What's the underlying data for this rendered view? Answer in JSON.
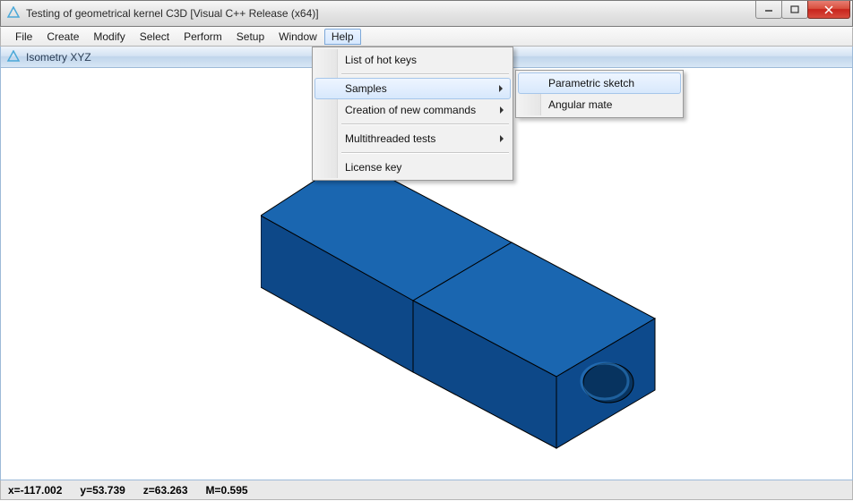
{
  "titlebar": {
    "title": "Testing of geometrical kernel C3D [Visual C++ Release (x64)]"
  },
  "menubar": {
    "items": [
      "File",
      "Create",
      "Modify",
      "Select",
      "Perform",
      "Setup",
      "Window",
      "Help"
    ],
    "open_index": 7
  },
  "view_header": {
    "label": "Isometry XYZ"
  },
  "help_menu": {
    "items": [
      {
        "label": "List of hot keys",
        "submenu": false
      },
      {
        "separator": true
      },
      {
        "label": "Samples",
        "submenu": true,
        "hover": true
      },
      {
        "label": "Creation of new commands",
        "submenu": true
      },
      {
        "separator": true
      },
      {
        "label": "Multithreaded tests",
        "submenu": true
      },
      {
        "separator": true
      },
      {
        "label": "License key",
        "submenu": false
      }
    ]
  },
  "samples_submenu": {
    "items": [
      {
        "label": "Parametric sketch",
        "hover": true
      },
      {
        "label": "Angular mate"
      }
    ]
  },
  "statusbar": {
    "x": "x=-117.002",
    "y": "y=53.739",
    "z": "z=63.263",
    "m": "M=0.595"
  },
  "colors": {
    "model_top": "#1a66b0",
    "model_side": "#0d4888",
    "model_front": "#0d4a8c"
  }
}
